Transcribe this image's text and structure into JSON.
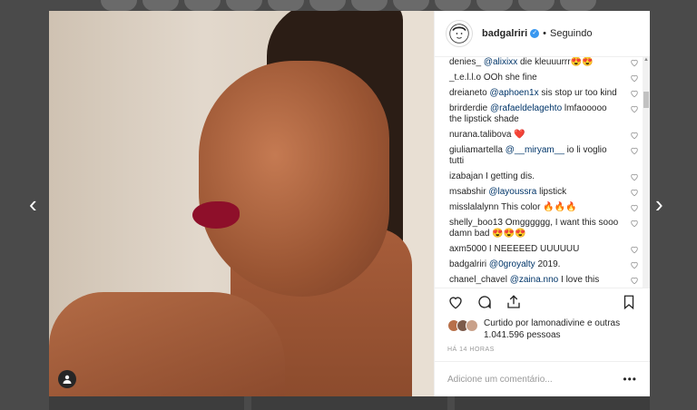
{
  "post": {
    "username": "badgalriri",
    "follow_dot": "•",
    "follow_label": "Seguindo"
  },
  "comments": [
    {
      "user": "denies_",
      "mention": "@alixixx",
      "text": "die kleuuurrr😍😍",
      "liked": false
    },
    {
      "user": "_t.e.l.l.o",
      "mention": "",
      "text": "OOh she fine",
      "liked": false
    },
    {
      "user": "dreianeto",
      "mention": "@aphoen1x",
      "text": "sis stop ur too kind",
      "liked": false
    },
    {
      "user": "brirderdie",
      "mention": "@rafaeldelagehto",
      "text": "lmfaooooo the lipstick shade",
      "liked": false
    },
    {
      "user": "nurana.talibova",
      "mention": "",
      "text": "❤️",
      "liked": false
    },
    {
      "user": "giuliamartella",
      "mention": "@__miryam__",
      "text": "io li voglio tutti",
      "liked": false
    },
    {
      "user": "izabajan",
      "mention": "",
      "text": "I getting dis.",
      "liked": false
    },
    {
      "user": "msabshir",
      "mention": "@layoussra",
      "text": "lipstick",
      "liked": false
    },
    {
      "user": "misslalalynn",
      "mention": "",
      "text": "This color 🔥🔥🔥",
      "liked": false
    },
    {
      "user": "shelly_boo13",
      "mention": "",
      "text": "Omgggggg, I want this sooo damn bad 😍😍😍",
      "liked": false
    },
    {
      "user": "axm5000",
      "mention": "",
      "text": "I NEEEEED UUUUUU",
      "liked": false
    },
    {
      "user": "badgalriri",
      "mention": "@0groyalty",
      "text": "2019.",
      "liked": false
    },
    {
      "user": "chanel_chavel",
      "mention": "@zaina.nno",
      "text": "I love this",
      "liked": false
    }
  ],
  "likes": {
    "text": "Curtido por lamonadivine e outras 1.041.596 pessoas"
  },
  "time": "HÁ 14 HORAS",
  "add_comment": {
    "placeholder": "Adicione um comentário...",
    "more": "•••"
  },
  "nav": {
    "prev": "‹",
    "next": "›"
  },
  "icons": {
    "verified": "verified-badge",
    "heart": "heart-icon",
    "comment": "comment-icon",
    "share": "share-icon",
    "save": "bookmark-icon",
    "user_tag": "user-tag-icon"
  },
  "colors": {
    "mention": "#003569",
    "verified": "#3897f0",
    "liked_heart": "#ed4956"
  }
}
